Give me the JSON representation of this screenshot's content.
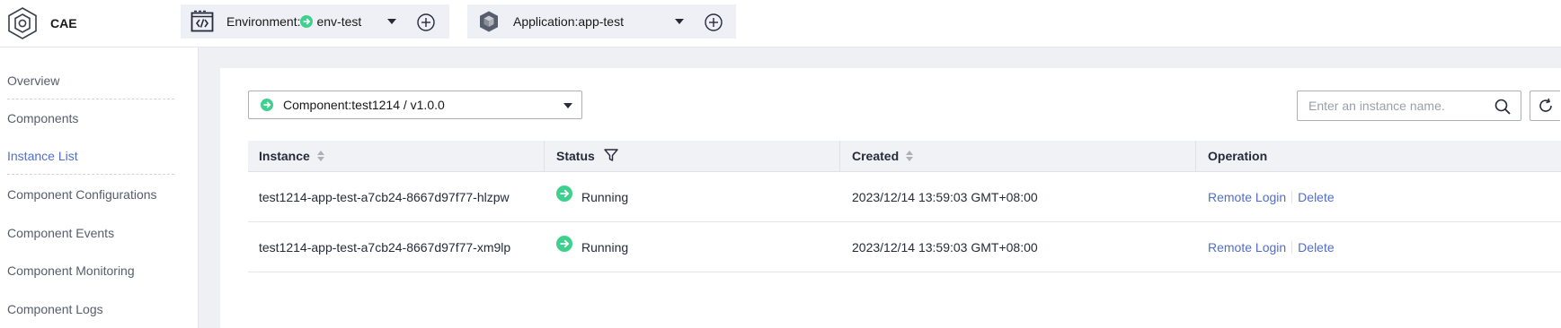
{
  "brand": {
    "name": "CAE",
    "logo_icon": "hexagon-logo-icon"
  },
  "context": {
    "environment": {
      "label": "Environment:",
      "value": "env-test",
      "icon": "code-window-icon"
    },
    "application": {
      "label": "Application:app-test",
      "icon": "cube-icon"
    }
  },
  "sidebar": {
    "items": [
      {
        "label": "Overview"
      },
      {
        "label": "Components"
      },
      {
        "label": "Instance List",
        "active": true
      },
      {
        "label": "Component Configurations"
      },
      {
        "label": "Component Events"
      },
      {
        "label": "Component Monitoring"
      },
      {
        "label": "Component Logs"
      }
    ]
  },
  "main": {
    "component_select": {
      "value": "Component:test1214 / v1.0.0"
    },
    "search": {
      "placeholder": "Enter an instance name."
    },
    "table": {
      "columns": [
        "Instance",
        "Status",
        "Created",
        "Operation"
      ],
      "rows": [
        {
          "instance": "test1214-app-test-a7cb24-8667d97f77-hlzpw",
          "status": "Running",
          "created": "2023/12/14 13:59:03 GMT+08:00",
          "op_login": "Remote Login",
          "op_delete": "Delete"
        },
        {
          "instance": "test1214-app-test-a7cb24-8667d97f77-xm9lp",
          "status": "Running",
          "created": "2023/12/14 13:59:03 GMT+08:00",
          "op_login": "Remote Login",
          "op_delete": "Delete"
        }
      ]
    }
  },
  "colors": {
    "accent": "#526ecc",
    "status_running": "#3fcf8e",
    "page_bg": "#eff0f3"
  }
}
